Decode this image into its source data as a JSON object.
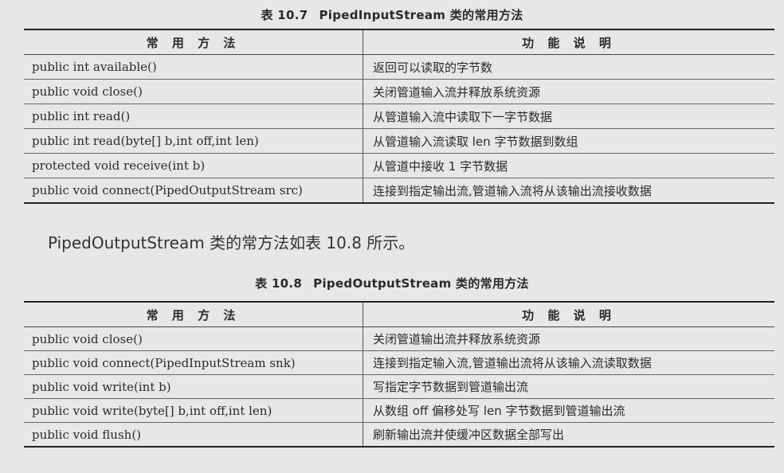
{
  "table1": {
    "caption_num": "表 10.7",
    "caption_title": "PipedInputStream 类的常用方法",
    "headers": [
      "常 用 方 法",
      "功 能 说 明"
    ],
    "rows": [
      [
        "public int available()",
        "返回可以读取的字节数"
      ],
      [
        "public void close()",
        "关闭管道输入流并释放系统资源"
      ],
      [
        "public int read()",
        "从管道输入流中读取下一字节数据"
      ],
      [
        "public int read(byte[] b,int off,int len)",
        "从管道输入流读取 len 字节数据到数组"
      ],
      [
        "protected void receive(int b)",
        "从管道中接收 1 字节数据"
      ],
      [
        "public void connect(PipedOutputStream src)",
        "连接到指定输出流,管道输入流将从该输出流接收数据"
      ]
    ]
  },
  "paragraph": "PipedOutputStream 类的常方法如表 10.8 所示。",
  "table2": {
    "caption_num": "表 10.8",
    "caption_title": "PipedOutputStream 类的常用方法",
    "headers": [
      "常 用 方 法",
      "功 能 说 明"
    ],
    "rows": [
      [
        "public void close()",
        "关闭管道输出流并释放系统资源"
      ],
      [
        "public void connect(PipedInputStream snk)",
        "连接到指定输入流,管道输出流将从该输入流读取数据"
      ],
      [
        "public void write(int b)",
        "写指定字节数据到管道输出流"
      ],
      [
        "public void write(byte[] b,int off,int len)",
        "从数组 off 偏移处写 len 字节数据到管道输出流"
      ],
      [
        "public void flush()",
        "刷新输出流并使缓冲区数据全部写出"
      ]
    ]
  }
}
